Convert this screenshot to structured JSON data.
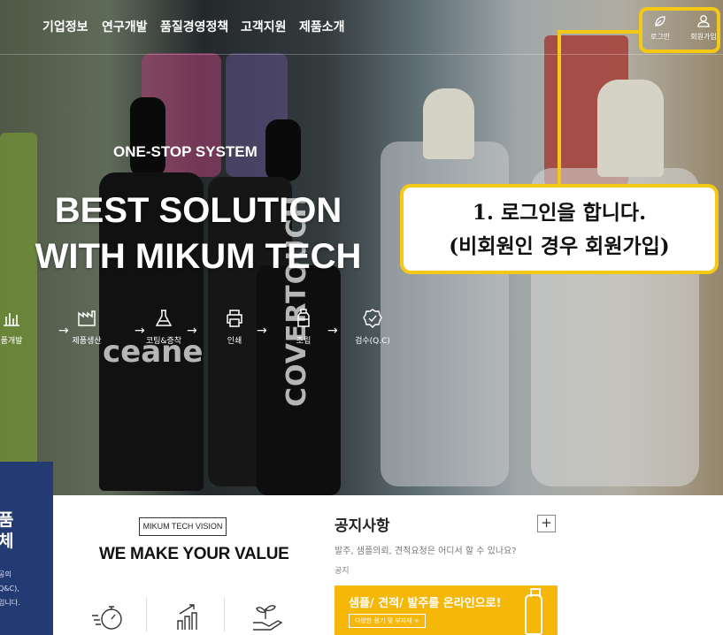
{
  "nav": {
    "items": [
      {
        "label": "기업정보"
      },
      {
        "label": "연구개발"
      },
      {
        "label": "품질경영정책"
      },
      {
        "label": "고객지원"
      },
      {
        "label": "제품소개"
      }
    ],
    "login": {
      "label": "로그인",
      "icon": "leaf-icon"
    },
    "signup": {
      "label": "회원가입",
      "icon": "user-icon"
    }
  },
  "annotation": {
    "line1": "1. 로그인을 합니다.",
    "line2": "(비회원인 경우 회원가입)",
    "color": "#f3c915"
  },
  "hero": {
    "subtitle": "ONE-STOP SYSTEM",
    "title_line1": "BEST SOLUTION",
    "title_line2": "WITH MIKUM TECH",
    "bottle_text1": "ceane",
    "bottle_text2": "COVERTOUCH",
    "steps": [
      {
        "label": "품개발",
        "icon": "bar-chart-icon"
      },
      {
        "label": "제품생산",
        "icon": "factory-icon"
      },
      {
        "label": "코팅&증착",
        "icon": "flask-icon"
      },
      {
        "label": "인쇄",
        "icon": "printer-icon"
      },
      {
        "label": "조립",
        "icon": "bottle-icon"
      },
      {
        "label": "검수(Q.C)",
        "icon": "check-badge-icon"
      }
    ]
  },
  "side_panel": {
    "title_line1": "품",
    "title_line2": "체",
    "text_line1": "공의",
    "text_line2": "Q&C),",
    "text_line3": "입니다.",
    "color": "#243a73"
  },
  "vision": {
    "tag": "MIKUM TECH VISION",
    "title": "WE MAKE YOUR VALUE",
    "icons": [
      "stopwatch-icon",
      "growth-chart-icon",
      "plant-hand-icon"
    ]
  },
  "notice": {
    "title": "공지사항",
    "plus": "+",
    "question": "발주, 샘플의뢰, 견적요청은 어디서 할 수 있나요?",
    "category": "공지"
  },
  "promo": {
    "title": "샘플/ 견적/ 발주를 온라인으로!",
    "button": "다양한 용기 및 부자재 +",
    "color": "#f5b708"
  }
}
